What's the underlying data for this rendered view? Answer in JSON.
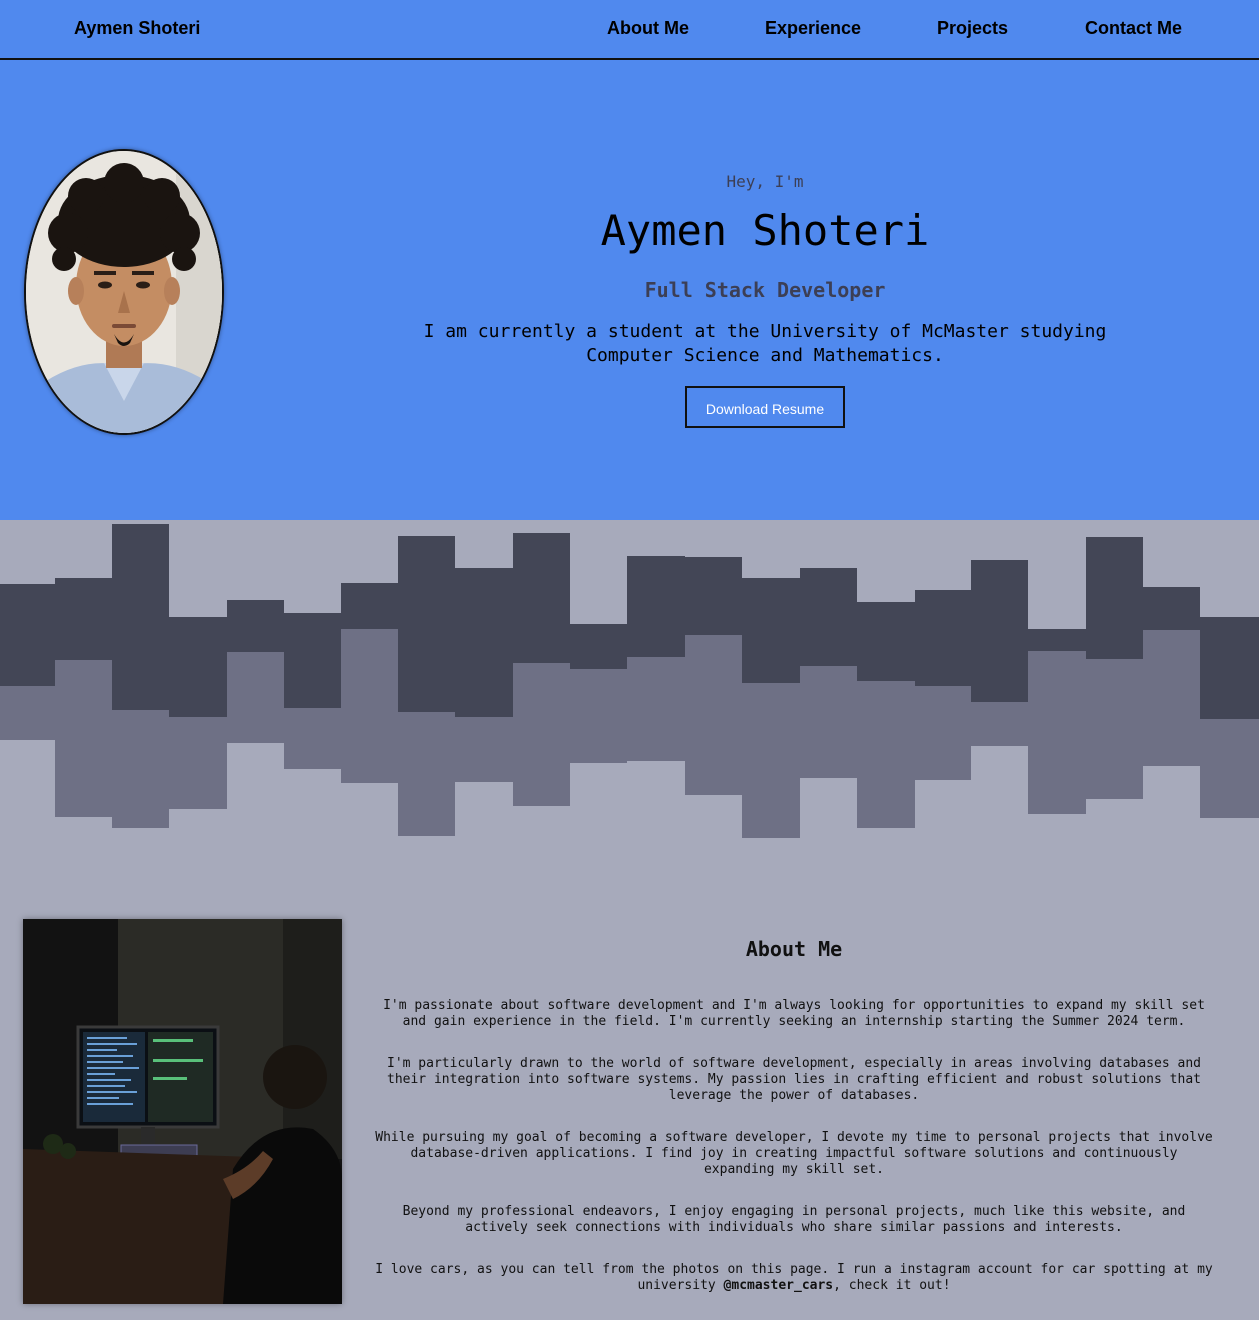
{
  "navbar": {
    "brand": "Aymen Shoteri",
    "links": [
      "About Me",
      "Experience",
      "Projects",
      "Contact Me"
    ]
  },
  "hero": {
    "greeting": "Hey, I'm",
    "name": "Aymen Shoteri",
    "role": "Full Stack Developer",
    "intro": "I am currently a student at the University of McMaster studying Computer Science and Mathematics.",
    "resume_button": "Download Resume"
  },
  "about": {
    "title": "About Me",
    "paragraphs": [
      "I'm passionate about software development and I'm always looking for opportunities to expand my skill set and gain experience in the field. I'm currently seeking an internship starting the Summer 2024 term.",
      "I'm particularly drawn to the world of software development, especially in areas involving databases and their integration into software systems. My passion lies in crafting efficient and robust solutions that leverage the power of databases.",
      "While pursuing my goal of becoming a software developer, I devote my time to personal projects that involve database-driven applications. I find joy in creating impactful software solutions and continuously expanding my skill set.",
      "Beyond my professional endeavors, I enjoy engaging in personal projects, much like this website, and actively seek connections with individuals who share similar passions and interests."
    ],
    "last_paragraph_before": "I love cars, as you can tell from the photos on this page. I run a instagram account for car spotting at my university ",
    "instagram_handle": "@mcmaster_cars",
    "last_paragraph_after": ", check it out!"
  },
  "colors": {
    "hero_blue": "#5089ee",
    "skyline_dark": "#434656",
    "skyline_mid": "#6e7085",
    "skyline_light": "#a7aabb"
  },
  "icons": {
    "profile": "profile-photo",
    "desk": "desk-setup-photo"
  }
}
